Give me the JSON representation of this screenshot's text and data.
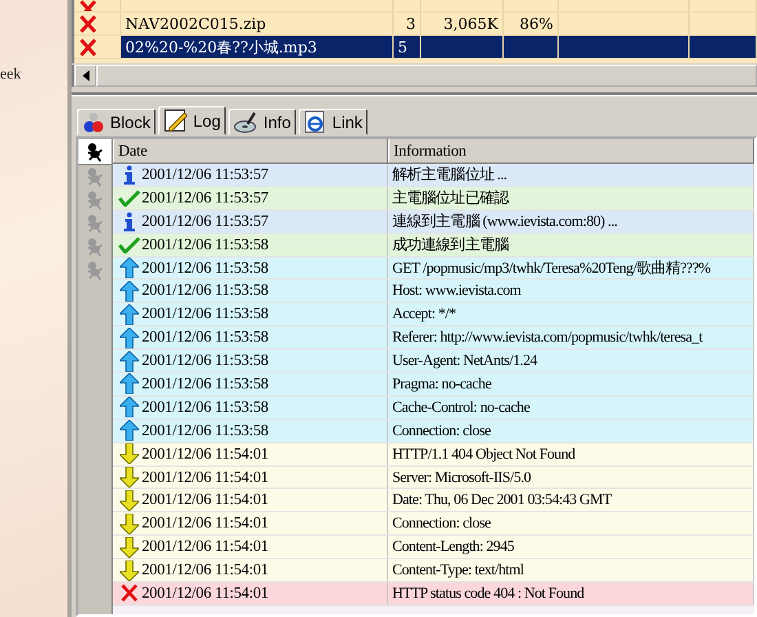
{
  "sidebar": {
    "text": "eek"
  },
  "downloads": {
    "rows": [
      {
        "name": "NAV2002C015.zip",
        "column_2": "3",
        "size": "3,065K",
        "percent": "86%",
        "selected": false
      },
      {
        "name": "02%20-%20春??小城.mp3",
        "column_2": "5",
        "selected": true
      }
    ]
  },
  "tabs": [
    {
      "label": "Block",
      "kind": "block",
      "selected": false
    },
    {
      "label": "Log",
      "kind": "log",
      "selected": true
    },
    {
      "label": "Info",
      "kind": "info",
      "selected": false
    },
    {
      "label": "Link",
      "kind": "link",
      "selected": false
    }
  ],
  "log": {
    "columns": [
      "Date",
      "Information"
    ],
    "rows": [
      {
        "kind": "info",
        "date": "2001/12/06 11:53:57",
        "information": "解析主電腦位址 ..."
      },
      {
        "kind": "success",
        "date": "2001/12/06 11:53:57",
        "information": "主電腦位址已確認"
      },
      {
        "kind": "info",
        "date": "2001/12/06 11:53:57",
        "information": "連線到主電腦 (www.ievista.com:80) ..."
      },
      {
        "kind": "success",
        "date": "2001/12/06 11:53:58",
        "information": "成功連線到主電腦"
      },
      {
        "kind": "sent",
        "date": "2001/12/06 11:53:58",
        "information": "GET /popmusic/mp3/twhk/Teresa%20Teng/歌曲精???%"
      },
      {
        "kind": "sent",
        "date": "2001/12/06 11:53:58",
        "information": "Host: www.ievista.com"
      },
      {
        "kind": "sent",
        "date": "2001/12/06 11:53:58",
        "information": "Accept: */*"
      },
      {
        "kind": "sent",
        "date": "2001/12/06 11:53:58",
        "information": "Referer: http://www.ievista.com/popmusic/twhk/teresa_t"
      },
      {
        "kind": "sent",
        "date": "2001/12/06 11:53:58",
        "information": "User-Agent: NetAnts/1.24"
      },
      {
        "kind": "sent",
        "date": "2001/12/06 11:53:58",
        "information": "Pragma: no-cache"
      },
      {
        "kind": "sent",
        "date": "2001/12/06 11:53:58",
        "information": "Cache-Control: no-cache"
      },
      {
        "kind": "sent",
        "date": "2001/12/06 11:53:58",
        "information": "Connection: close"
      },
      {
        "kind": "received",
        "date": "2001/12/06 11:54:01",
        "information": "HTTP/1.1 404 Object Not Found"
      },
      {
        "kind": "received",
        "date": "2001/12/06 11:54:01",
        "information": "Server: Microsoft-IIS/5.0"
      },
      {
        "kind": "received",
        "date": "2001/12/06 11:54:01",
        "information": "Date: Thu, 06 Dec 2001 03:54:43 GMT"
      },
      {
        "kind": "received",
        "date": "2001/12/06 11:54:01",
        "information": "Connection: close"
      },
      {
        "kind": "received",
        "date": "2001/12/06 11:54:01",
        "information": "Content-Length: 2945"
      },
      {
        "kind": "received",
        "date": "2001/12/06 11:54:01",
        "information": "Content-Type: text/html"
      },
      {
        "kind": "error",
        "date": "2001/12/06 11:54:01",
        "information": "HTTP status code 404 : Not Found"
      }
    ]
  }
}
